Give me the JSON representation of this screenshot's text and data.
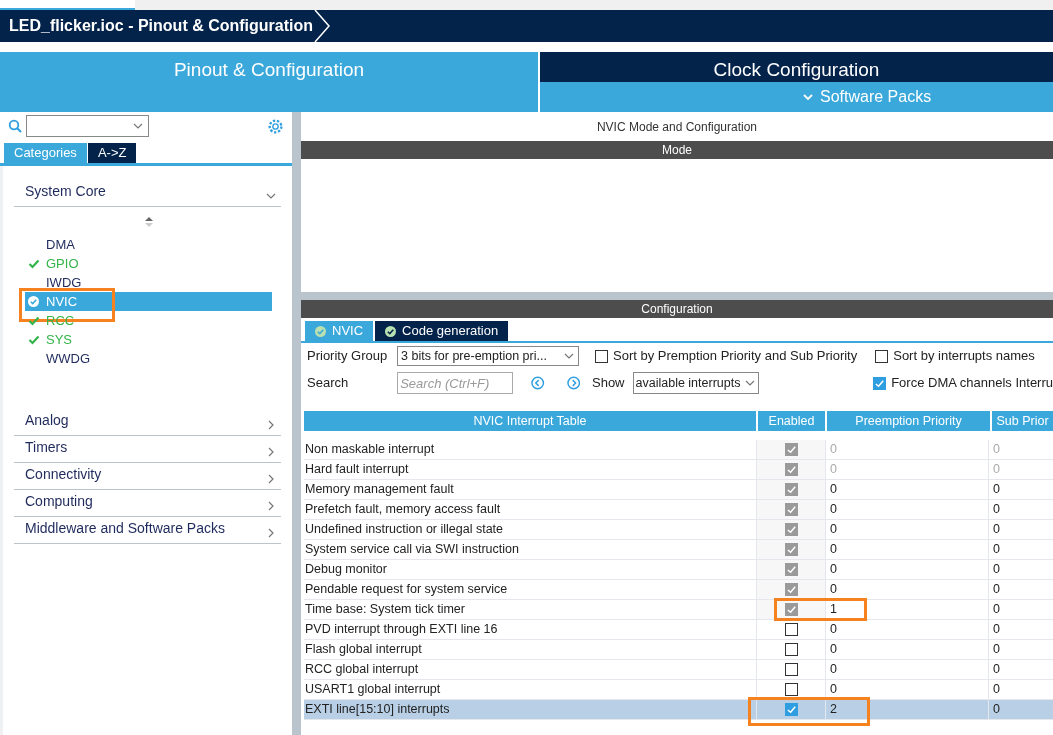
{
  "breadcrumb": {
    "title": "LED_flicker.ioc - Pinout & Configuration"
  },
  "main_tabs": [
    {
      "label": "Pinout & Configuration",
      "selected": true
    },
    {
      "label": "Clock Configuration",
      "selected": false
    }
  ],
  "software_packs": {
    "label": "Software Packs"
  },
  "sidebar": {
    "view_tabs": [
      {
        "label": "Categories",
        "selected": true
      },
      {
        "label": "A->Z",
        "selected": false
      }
    ],
    "categories": [
      {
        "label": "System Core",
        "expanded": true,
        "items": [
          {
            "label": "DMA",
            "configured": false,
            "selected": false,
            "highlighted": false
          },
          {
            "label": "GPIO",
            "configured": true,
            "selected": false,
            "highlighted": false
          },
          {
            "label": "IWDG",
            "configured": false,
            "selected": false,
            "highlighted": false
          },
          {
            "label": "NVIC",
            "configured": true,
            "selected": true,
            "highlighted": true
          },
          {
            "label": "RCC",
            "configured": true,
            "selected": false,
            "highlighted": false
          },
          {
            "label": "SYS",
            "configured": true,
            "selected": false,
            "highlighted": false
          },
          {
            "label": "WWDG",
            "configured": false,
            "selected": false,
            "highlighted": false
          }
        ]
      },
      {
        "label": "Analog",
        "expanded": false
      },
      {
        "label": "Timers",
        "expanded": false
      },
      {
        "label": "Connectivity",
        "expanded": false
      },
      {
        "label": "Computing",
        "expanded": false
      },
      {
        "label": "Middleware and Software Packs",
        "expanded": false
      }
    ]
  },
  "panel": {
    "title": "NVIC Mode and Configuration",
    "mode_header": "Mode",
    "config_header": "Configuration",
    "config_tabs": [
      {
        "label": "NVIC",
        "selected": true
      },
      {
        "label": "Code generation",
        "selected": false
      }
    ],
    "priority_group": {
      "label": "Priority Group",
      "value": "3 bits for pre-emption pri..."
    },
    "sort_options": [
      {
        "label": "Sort by Premption Priority and Sub Priority",
        "checked": false
      },
      {
        "label": "Sort by interrupts names",
        "checked": false
      }
    ],
    "search": {
      "label": "Search",
      "placeholder": "Search (Ctrl+F)"
    },
    "show": {
      "label": "Show",
      "value": "available interrupts"
    },
    "force_dma": {
      "label": "Force DMA channels Interru",
      "checked": true
    },
    "table": {
      "columns": [
        "NVIC Interrupt Table",
        "Enabled",
        "Preemption Priority",
        "Sub Prior"
      ],
      "rows": [
        {
          "name": "Non maskable interrupt",
          "enabled": true,
          "locked": true,
          "priority_locked": true,
          "preemption": "0",
          "sub": "0",
          "selected": false,
          "highlighted": false
        },
        {
          "name": "Hard fault interrupt",
          "enabled": true,
          "locked": true,
          "priority_locked": true,
          "preemption": "0",
          "sub": "0",
          "selected": false,
          "highlighted": false
        },
        {
          "name": "Memory management fault",
          "enabled": true,
          "locked": true,
          "priority_locked": false,
          "preemption": "0",
          "sub": "0",
          "selected": false,
          "highlighted": false
        },
        {
          "name": "Prefetch fault, memory access fault",
          "enabled": true,
          "locked": true,
          "priority_locked": false,
          "preemption": "0",
          "sub": "0",
          "selected": false,
          "highlighted": false
        },
        {
          "name": "Undefined instruction or illegal state",
          "enabled": true,
          "locked": true,
          "priority_locked": false,
          "preemption": "0",
          "sub": "0",
          "selected": false,
          "highlighted": false
        },
        {
          "name": "System service call via SWI instruction",
          "enabled": true,
          "locked": true,
          "priority_locked": false,
          "preemption": "0",
          "sub": "0",
          "selected": false,
          "highlighted": false
        },
        {
          "name": "Debug monitor",
          "enabled": true,
          "locked": true,
          "priority_locked": false,
          "preemption": "0",
          "sub": "0",
          "selected": false,
          "highlighted": false
        },
        {
          "name": "Pendable request for system service",
          "enabled": true,
          "locked": true,
          "priority_locked": false,
          "preemption": "0",
          "sub": "0",
          "selected": false,
          "highlighted": false
        },
        {
          "name": "Time base: System tick timer",
          "enabled": true,
          "locked": true,
          "priority_locked": false,
          "preemption": "1",
          "sub": "0",
          "selected": false,
          "highlighted": true
        },
        {
          "name": "PVD interrupt through EXTI line 16",
          "enabled": false,
          "locked": false,
          "priority_locked": false,
          "preemption": "0",
          "sub": "0",
          "selected": false,
          "highlighted": false
        },
        {
          "name": "Flash global interrupt",
          "enabled": false,
          "locked": false,
          "priority_locked": false,
          "preemption": "0",
          "sub": "0",
          "selected": false,
          "highlighted": false
        },
        {
          "name": "RCC global interrupt",
          "enabled": false,
          "locked": false,
          "priority_locked": false,
          "preemption": "0",
          "sub": "0",
          "selected": false,
          "highlighted": false
        },
        {
          "name": "USART1 global interrupt",
          "enabled": false,
          "locked": false,
          "priority_locked": false,
          "preemption": "0",
          "sub": "0",
          "selected": false,
          "highlighted": false
        },
        {
          "name": "EXTI line[15:10] interrupts",
          "enabled": true,
          "locked": false,
          "priority_locked": false,
          "preemption": "2",
          "sub": "0",
          "selected": true,
          "highlighted": true
        }
      ]
    }
  }
}
